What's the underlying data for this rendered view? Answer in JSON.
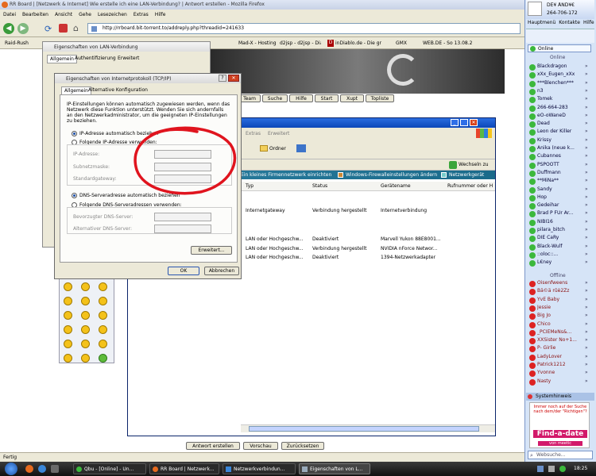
{
  "browser": {
    "title": "RR Board | [Netzwerk & Internet] Wie erstelle ich eine LAN-Verbindung? | Antwort erstellen - Mozilla Firefox",
    "menu": [
      "Datei",
      "Bearbeiten",
      "Ansicht",
      "Gehe",
      "Lesezeichen",
      "Extras",
      "Hilfe"
    ],
    "url": "http://rrboard.bit-torrent.to/addreply.php?threadid=241633",
    "bookmarks": [
      "Raid-Rush",
      "Mad-X - Hosting",
      "d2jsp - d2jsp - Diablo 2",
      "inDiablo.de - Die gross…",
      "GMX",
      "WEB.DE - So 13.08.200"
    ],
    "forum_nav": [
      "Team",
      "Suche",
      "Hilfe",
      "Start",
      "Xupt",
      "Topliste"
    ],
    "reply_buttons": [
      "Antwort erstellen",
      "Vorschau",
      "Zurücksetzen"
    ],
    "status": "Fertig"
  },
  "lan_dialog": {
    "title": "Eigenschaften von LAN-Verbindung",
    "tabs": [
      "Allgemein",
      "Authentifizierung",
      "Erweitert"
    ]
  },
  "tcp_dialog": {
    "title": "Eigenschaften von Internetprotokoll (TCP/IP)",
    "tabs": [
      "Allgemein",
      "Alternative Konfiguration"
    ],
    "intro": "IP-Einstellungen können automatisch zugewiesen werden, wenn das Netzwerk diese Funktion unterstützt. Wenden Sie sich andernfalls an den Netzwerkadministrator, um die geeigneten IP-Einstellungen zu beziehen.",
    "ip_auto": "IP-Adresse automatisch beziehen",
    "ip_manual": "Folgende IP-Adresse verwenden:",
    "ip_fields": [
      "IP-Adresse:",
      "Subnetzmaske:",
      "Standardgateway:"
    ],
    "dns_auto": "DNS-Serveradresse automatisch beziehen",
    "dns_manual": "Folgende DNS-Serveradressen verwenden:",
    "dns_fields": [
      "Bevorzugter DNS-Server:",
      "Alternativer DNS-Server:"
    ],
    "advanced": "Erweitert...",
    "ok": "OK",
    "cancel": "Abbrechen"
  },
  "net_window": {
    "menu": [
      "Extras",
      "Erweitert"
    ],
    "toolbar_folders": "Ordner",
    "search_label": "Wechseln zu",
    "tasks": [
      "Ein kleines Firmennetzwerk einrichten",
      "Windows-Firewalleinstellungen ändern",
      "Netzwerkgerät"
    ],
    "columns": [
      "Typ",
      "Status",
      "Gerätename",
      "Rufnummer oder H"
    ],
    "rows": [
      {
        "typ": "Internetgateway",
        "status": "Verbindung hergestellt",
        "device": "Internetverbindung"
      },
      {
        "typ": "LAN oder Hochgeschw...",
        "status": "Deaktiviert",
        "device": "Marvell Yukon 88E8001..."
      },
      {
        "typ": "LAN oder Hochgeschw...",
        "status": "Verbindung hergestellt",
        "device": "NVIDIA nForce Networ..."
      },
      {
        "typ": "LAN oder Hochgeschw...",
        "status": "Deaktiviert",
        "device": "1394-Netzwerkadapter"
      }
    ]
  },
  "icq": {
    "user_name": "DE¥ ÅÑD¥€",
    "user_number": "264-706-172",
    "tabs": [
      "Hauptmenü",
      "Kontakte",
      "Hilfe"
    ],
    "status": "Online",
    "online_header": "Online",
    "offline_header": "Offline",
    "online_contacts": [
      "Blackdragon",
      "xXx_Eugen_xXx",
      "***Blenchen***",
      "n3",
      "Tomek",
      "266-664-283",
      "eO-oWaneD",
      "Dead",
      "Leon der Killer",
      "Krissy",
      "Anika (neue k...",
      "Cubannes",
      "PSPOOTT",
      "Duffmann",
      "**MiNa**",
      "Sandy",
      "Hop",
      "Gedeihar",
      "Brad P FÜr Ar...",
      "NIBI16",
      "pilara_bitch",
      "DIE CaRy",
      "Black-Wulf",
      "::oloc::...",
      "L€ney"
    ],
    "offline_contacts": [
      "Oisenfweens",
      "Bä©ä rûè2Zz",
      "YvE Baby",
      "Jessie",
      "Big Jo",
      "Chico",
      "_PCIEMeNs&...",
      "XXSister No+1...",
      "P- Girlie",
      "LadyLover",
      "Patrick1212",
      "Yvonne",
      "Nasty"
    ],
    "system_msg": "Systemhinweis",
    "ad_text": "Immer noch auf der Suche nach dem/der \"Richtigen\"?",
    "ad_brand": "Find-a-date",
    "ad_sub": "von meetic",
    "search_placeholder": "Websuche..."
  },
  "taskbar": {
    "items": [
      "Qbu - [Online] - Un...",
      "RR Board | Netzwerk...",
      "Netzwerkverbindun...",
      "Eigenschaften von L..."
    ],
    "clock": "18:25"
  },
  "colors": {
    "xp_blue": "#245edb",
    "annotation_red": "#e0141e",
    "icq_bg": "#d6e4f7"
  }
}
